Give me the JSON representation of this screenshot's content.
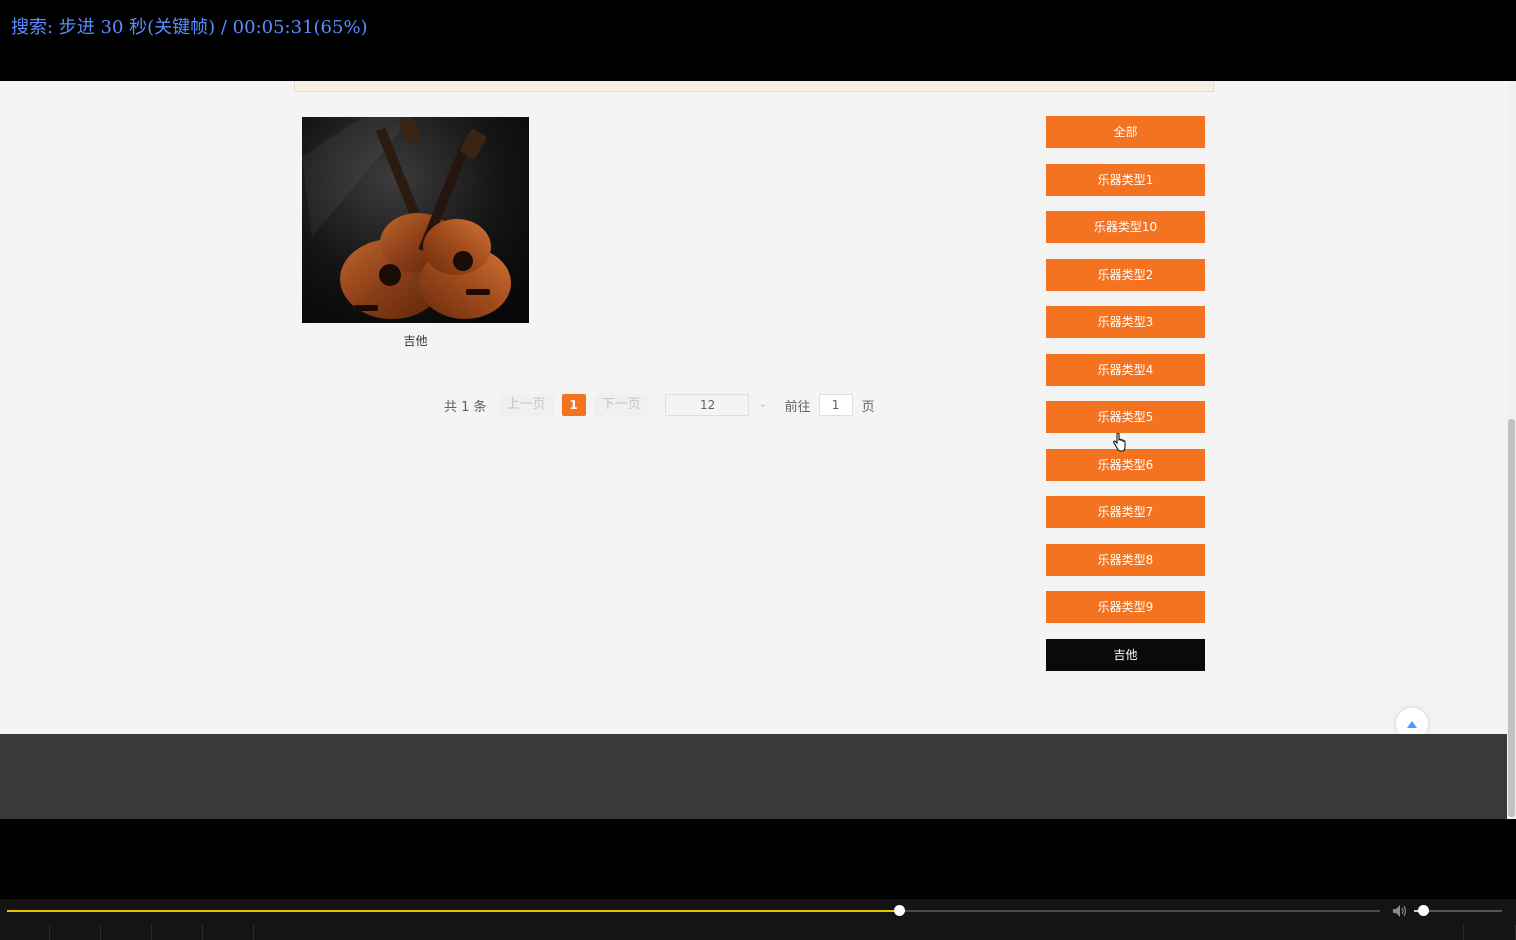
{
  "osd": {
    "status_text": "搜索: 步进 30 秒(关键帧) / 00:05:31(65%)"
  },
  "product": {
    "name": "吉他",
    "image_alt": "吉他"
  },
  "pagination": {
    "total_text": "共 1 条",
    "prev_label": "上一页",
    "current_page": "1",
    "next_label": "下一页",
    "page_size": "12",
    "goto_label": "前往",
    "goto_value": "1",
    "page_suffix": "页"
  },
  "categories": [
    {
      "label": "全部",
      "active": false
    },
    {
      "label": "乐器类型1",
      "active": false
    },
    {
      "label": "乐器类型10",
      "active": false
    },
    {
      "label": "乐器类型2",
      "active": false
    },
    {
      "label": "乐器类型3",
      "active": false
    },
    {
      "label": "乐器类型4",
      "active": false
    },
    {
      "label": "乐器类型5",
      "active": false
    },
    {
      "label": "乐器类型6",
      "active": false
    },
    {
      "label": "乐器类型7",
      "active": false
    },
    {
      "label": "乐器类型8",
      "active": false
    },
    {
      "label": "乐器类型9",
      "active": false
    },
    {
      "label": "吉他",
      "active": true
    }
  ],
  "player": {
    "seek_progress": 0.65,
    "volume_level": 0.1
  },
  "colors": {
    "accent": "#f47320",
    "active_category": "#0a0a0a",
    "osd_text": "#5b8cff",
    "seek_fill": "#e6c700",
    "footer": "#393939"
  },
  "icons": {
    "back_to_top": "arrow-up-icon",
    "cursor": "hand-pointer-icon",
    "volume": "speaker-icon",
    "select_chevron": "chevron-down-icon"
  }
}
